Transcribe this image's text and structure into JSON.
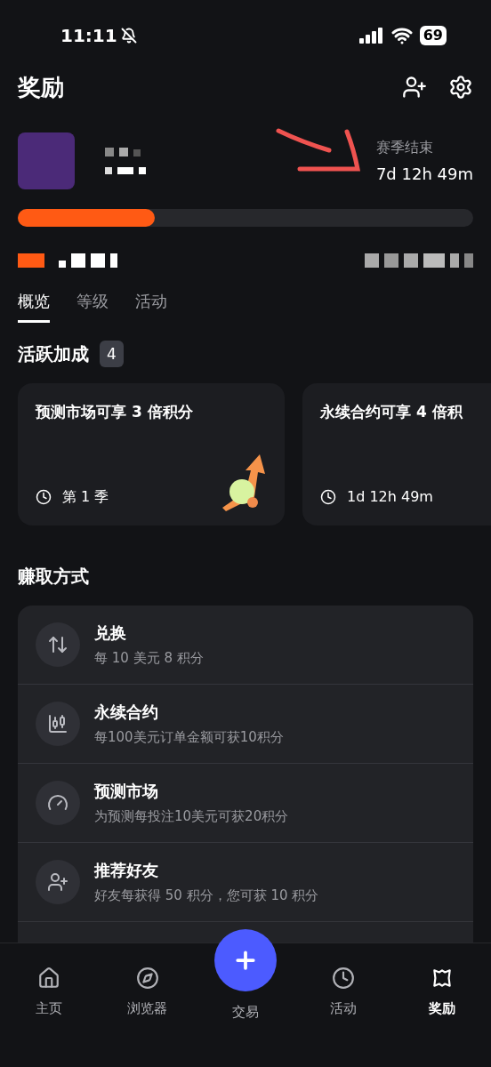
{
  "status_bar": {
    "time": "11:11",
    "battery": "69"
  },
  "header": {
    "title": "奖励"
  },
  "season": {
    "label": "赛季结束",
    "remaining": "7d 12h 49m"
  },
  "progress": {
    "level": 0.3
  },
  "tabs": [
    {
      "label": "概览",
      "selected": true
    },
    {
      "label": "等级",
      "selected": false
    },
    {
      "label": "活动",
      "selected": false
    }
  ],
  "boosts": {
    "title": "活跃加成",
    "count": "4",
    "cards": [
      {
        "title": "预测市场可享 3 倍积分",
        "footer": "第 1 季",
        "illustration": true
      },
      {
        "title": "永续合约可享 4 倍积",
        "footer": "1d 12h 49m",
        "illustration": false
      }
    ]
  },
  "earn": {
    "title": "赚取方式",
    "items": [
      {
        "kind": "swap",
        "title": "兑换",
        "subtitle": "每 10 美元 8 积分"
      },
      {
        "kind": "perps",
        "title": "永续合约",
        "subtitle": "每100美元订单金额可获10积分"
      },
      {
        "kind": "predict",
        "title": "预测市场",
        "subtitle": "为预测每投注10美元可获20积分"
      },
      {
        "kind": "referral",
        "title": "推荐好友",
        "subtitle": "好友每获得 50 积分，您可获 10 积分"
      }
    ]
  },
  "nav": [
    {
      "kind": "home",
      "label": "主页",
      "selected": false
    },
    {
      "kind": "browser",
      "label": "浏览器",
      "selected": false
    },
    {
      "kind": "trade",
      "label": "交易",
      "selected": false
    },
    {
      "kind": "activity",
      "label": "活动",
      "selected": false
    },
    {
      "kind": "rewards",
      "label": "奖励",
      "selected": true
    }
  ]
}
